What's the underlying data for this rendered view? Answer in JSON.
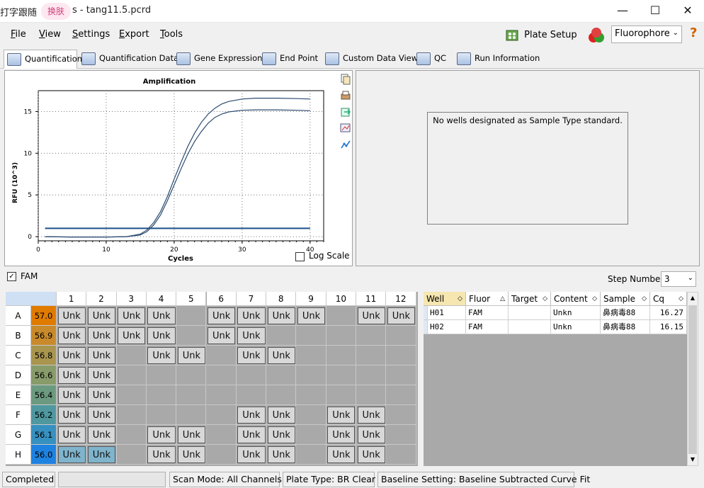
{
  "titlebar": {
    "prefix": "打字跟随",
    "badge": "换肤",
    "title": "s - tang11.5.pcrd",
    "minimize": "—",
    "maximize": "☐",
    "close": "✕"
  },
  "menu": [
    {
      "label": "File",
      "key": "F",
      "rest": "ile"
    },
    {
      "label": "View",
      "key": "V",
      "rest": "iew"
    },
    {
      "label": "Settings",
      "key": "S",
      "rest": "ettings"
    },
    {
      "label": "Export",
      "key": "E",
      "rest": "xport"
    },
    {
      "label": "Tools",
      "key": "T",
      "rest": "ools"
    }
  ],
  "toolbar": {
    "plate_setup": "Plate Setup",
    "fluorophore": "Fluorophore",
    "help": "?"
  },
  "tabs": [
    "Quantification",
    "Quantification Data",
    "Gene Expression",
    "End Point",
    "Custom Data View",
    "QC",
    "Run Information"
  ],
  "chart": {
    "title": "Amplification",
    "xlabel": "Cycles",
    "ylabel": "RFU (10^3)",
    "log_scale_label": "Log Scale"
  },
  "chart_data": {
    "type": "line",
    "title": "Amplification",
    "xlabel": "Cycles",
    "ylabel": "RFU (10^3)",
    "xlim": [
      0,
      42
    ],
    "ylim": [
      -0.5,
      17.5
    ],
    "xticks": [
      0,
      10,
      20,
      30,
      40
    ],
    "yticks": [
      0,
      5,
      10,
      15
    ],
    "grid": true,
    "threshold": 1.0,
    "series": [
      {
        "x": [
          1,
          5,
          10,
          13,
          15,
          16,
          17,
          18,
          19,
          20,
          21,
          22,
          23,
          24,
          25,
          26,
          27,
          28,
          30,
          32,
          35,
          38,
          40
        ],
        "y": [
          0,
          -0.05,
          -0.05,
          0.0,
          0.3,
          0.8,
          1.7,
          3.0,
          4.8,
          6.9,
          8.9,
          10.8,
          12.4,
          13.7,
          14.7,
          15.4,
          15.9,
          16.2,
          16.5,
          16.6,
          16.6,
          16.55,
          16.5
        ]
      },
      {
        "x": [
          1,
          5,
          10,
          13,
          15,
          16,
          17,
          18,
          19,
          20,
          21,
          22,
          23,
          24,
          25,
          26,
          27,
          28,
          30,
          32,
          35,
          38,
          40
        ],
        "y": [
          0,
          -0.05,
          -0.05,
          0.0,
          0.2,
          0.6,
          1.4,
          2.6,
          4.3,
          6.2,
          8.1,
          9.9,
          11.4,
          12.6,
          13.6,
          14.3,
          14.7,
          14.95,
          15.15,
          15.2,
          15.2,
          15.15,
          15.1
        ]
      }
    ]
  },
  "right_panel": {
    "message": "No wells designated as Sample Type standard."
  },
  "fam": {
    "label": "FAM",
    "step_label": "Step Number:",
    "step_value": "3"
  },
  "plate": {
    "columns": [
      "1",
      "2",
      "3",
      "4",
      "5",
      "6",
      "7",
      "8",
      "9",
      "10",
      "11",
      "12"
    ],
    "rows": [
      {
        "label": "A",
        "temp": "57.0",
        "color": "#e07b00",
        "wells": [
          "Unk",
          "Unk",
          "Unk",
          "Unk",
          "",
          "Unk",
          "Unk",
          "Unk",
          "Unk",
          "",
          "Unk",
          "Unk"
        ]
      },
      {
        "label": "B",
        "temp": "56.9",
        "color": "#c88a2a",
        "wells": [
          "Unk",
          "Unk",
          "Unk",
          "Unk",
          "",
          "Unk",
          "Unk",
          "",
          "",
          "",
          "",
          ""
        ]
      },
      {
        "label": "C",
        "temp": "56.8",
        "color": "#a9954e",
        "wells": [
          "Unk",
          "Unk",
          "",
          "Unk",
          "Unk",
          "",
          "Unk",
          "Unk",
          "",
          "",
          "",
          ""
        ]
      },
      {
        "label": "D",
        "temp": "56.6",
        "color": "#889b6a",
        "wells": [
          "Unk",
          "Unk",
          "",
          "",
          "",
          "",
          "",
          "",
          "",
          "",
          "",
          ""
        ]
      },
      {
        "label": "E",
        "temp": "56.4",
        "color": "#6c9a80",
        "wells": [
          "Unk",
          "Unk",
          "",
          "",
          "",
          "",
          "",
          "",
          "",
          "",
          "",
          ""
        ]
      },
      {
        "label": "F",
        "temp": "56.2",
        "color": "#4f98a0",
        "wells": [
          "Unk",
          "Unk",
          "",
          "",
          "",
          "",
          "Unk",
          "Unk",
          "",
          "Unk",
          "Unk",
          ""
        ]
      },
      {
        "label": "G",
        "temp": "56.1",
        "color": "#3690c0",
        "wells": [
          "Unk",
          "Unk",
          "",
          "Unk",
          "Unk",
          "",
          "Unk",
          "Unk",
          "",
          "Unk",
          "Unk",
          ""
        ]
      },
      {
        "label": "H",
        "temp": "56.0",
        "color": "#1e82e0",
        "wells": [
          "Unk",
          "Unk",
          "",
          "Unk",
          "Unk",
          "",
          "Unk",
          "Unk",
          "",
          "Unk",
          "Unk",
          ""
        ]
      }
    ]
  },
  "table": {
    "headers": [
      "Well",
      "Fluor",
      "Target",
      "Content",
      "Sample",
      "Cq"
    ],
    "rows": [
      [
        "H01",
        "FAM",
        "",
        "Unkn",
        "鼻病毒88",
        "16.27"
      ],
      [
        "H02",
        "FAM",
        "",
        "Unkn",
        "鼻病毒88",
        "16.15"
      ]
    ]
  },
  "statusbar": {
    "state": "Completed",
    "scan": "Scan Mode: All Channels",
    "plate_type": "Plate Type: BR Clear",
    "baseline": "Baseline Setting: Baseline Subtracted Curve Fit"
  }
}
